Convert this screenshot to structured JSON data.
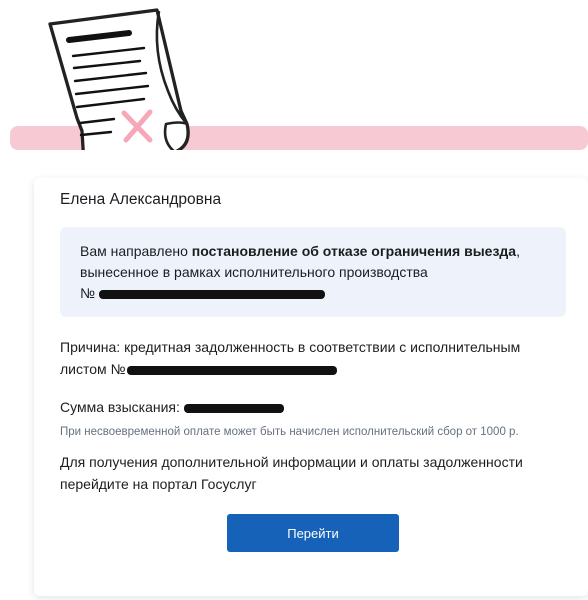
{
  "greeting": "Елена Александровна",
  "notice": {
    "prefix": "Вам направлено ",
    "bold": "постановление об отказе ограничения выезда",
    "suffix": ",",
    "line2": "вынесенное в рамках исполнительного производства",
    "number_label": "№ "
  },
  "reason": {
    "text": "Причина: кредитная задолженность в соответствии с исполнительным",
    "line2_label": "листом №"
  },
  "amount": {
    "label": "Сумма взыскания: "
  },
  "note": "При несвоевременной оплате может быть начислен исполнительский сбор от 1000 р.",
  "info": "Для получения дополнительной информации и оплаты задолженности перейдите на портал Госуслуг",
  "button": {
    "label": "Перейти",
    "color": "#1562b8"
  },
  "colors": {
    "accent_band": "#f7c9d3",
    "notice_background": "#eef3fb",
    "note_text": "#66717e"
  },
  "icons": {
    "illustration": "rejected-document-icon"
  }
}
